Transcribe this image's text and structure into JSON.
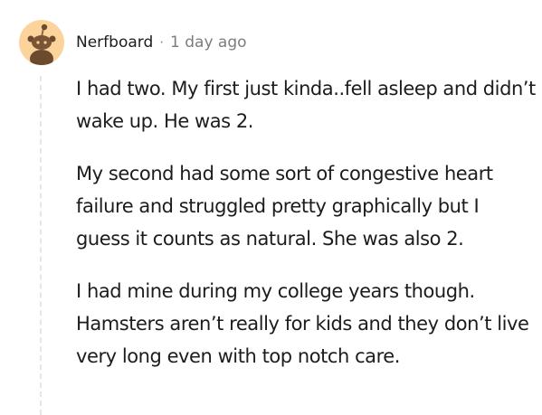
{
  "comment": {
    "author": "Nerfboard",
    "separator": "·",
    "timestamp": "1 day ago",
    "avatar_icon": "snoo-avatar-icon",
    "avatar_bg": "#fcd49b",
    "paragraphs": [
      "I had two. My first just kinda..fell asleep and didn’t wake up. He was 2.",
      "My second had some sort of congestive heart failure and struggled pretty graphically but I guess it counts as natural. She was also 2.",
      "I had mine during my college years though. Hamsters aren’t really for kids and they don’t live very long even with top notch care."
    ]
  }
}
